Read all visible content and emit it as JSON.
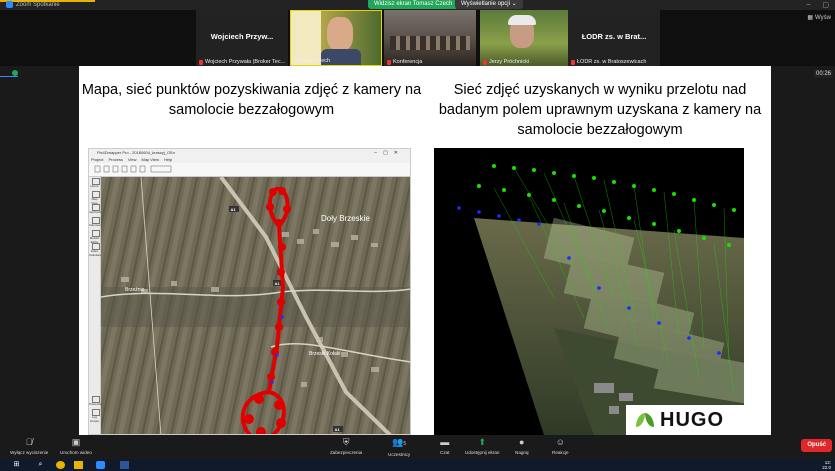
{
  "window": {
    "app_title": "Zoom Spotkanie",
    "share_banner": "Widzisz ekran Tomasz Czech",
    "view_options": "Wyświetlanie opcji ⌄",
    "gallery_label": "Wyśw"
  },
  "participants": [
    {
      "center_name": "Wojciech Przyw...",
      "caption": "Wojciech Przywała (Broker Tec..."
    },
    {
      "center_name": "",
      "caption": "Tomasz Czech"
    },
    {
      "center_name": "",
      "caption": "Konferencja"
    },
    {
      "center_name": "",
      "caption": "Jerzy Próchnicki"
    },
    {
      "center_name": "ŁODR zs. w Brat...",
      "caption": "ŁODR zs. w Bratoszewicach"
    }
  ],
  "meeting_timer": "00:26",
  "slide": {
    "left_heading": "Mapa, sieć punktów pozyskiwania zdjęć z kamery na samolocie bezzałogowym",
    "right_heading": "Sieć zdjęć uzyskanych w wyniku przelotu nad badanym polem uprawnym uzyskana z kamery na samolocie bezzałogowym",
    "pix4d": {
      "window_title": "Pix4Dmapper Pro - 20180604_kraszyj_OSn",
      "menu": [
        "Project",
        "Process",
        "View",
        "Map View",
        "Help"
      ],
      "sidebar": [
        "Home",
        "Map View",
        "rayCloud",
        "Volumes",
        "Mosaic Editor",
        "Index Calculator",
        "Processing",
        "Log Output"
      ],
      "map_labels": {
        "village_1": "Doły Brzeskie",
        "village_2": "Brzeski Kołaki",
        "village_3": "Brzeźnio",
        "road": "A1"
      }
    },
    "logo_text": "HUGO"
  },
  "toolbar": {
    "mute_video": "Wyłącz wyciszenie",
    "start_video": "Uruchom wideo",
    "security": "Zabezpieczenia",
    "participants": "Uczestnicy",
    "participants_count": "5",
    "chat": "Czat",
    "share_screen": "Udostępnij ekran",
    "record": "Nagraj",
    "reactions": "Reakcje",
    "end": "Opuść"
  },
  "taskbar": {
    "time": "12:",
    "date": "22.0"
  },
  "colors": {
    "share_green": "#23a55a",
    "end_red": "#e02828",
    "flight_path_red": "#e00000",
    "camera_green": "#18e000",
    "camera_blue": "#1a2cff"
  }
}
